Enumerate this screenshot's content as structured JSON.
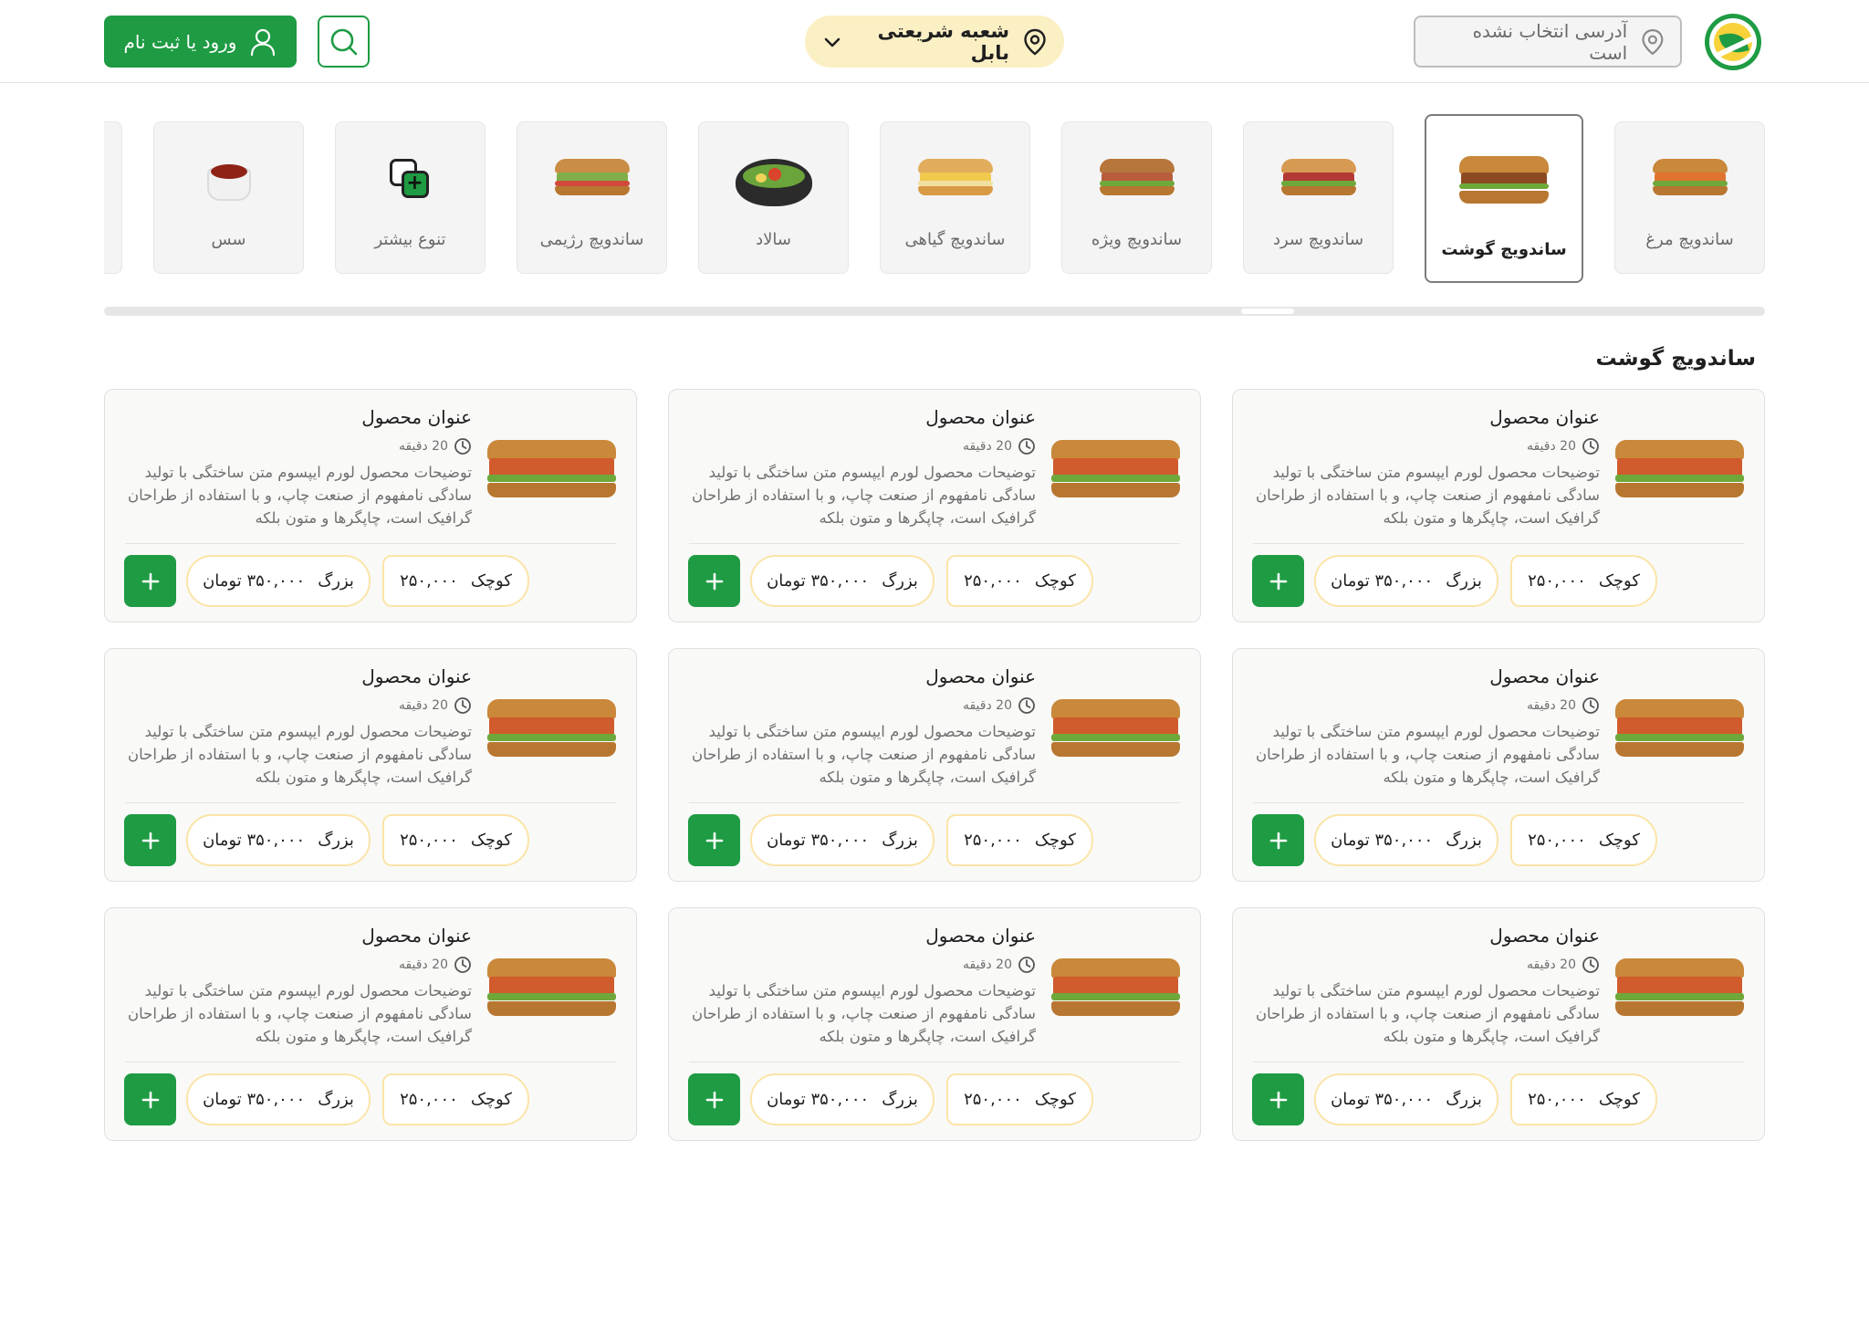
{
  "header": {
    "address_placeholder": "آدرسی انتخاب نشده است",
    "branch_label": "شعبه شریعتی بابل",
    "login_label": "ورود یا ثبت نام"
  },
  "categories": [
    {
      "label": "ساندویچ مرغ",
      "image": "chicken-sandwich",
      "active": false
    },
    {
      "label": "ساندویچ گوشت",
      "image": "meat-sandwich",
      "active": true
    },
    {
      "label": "ساندویچ سرد",
      "image": "cold-sandwich",
      "active": false
    },
    {
      "label": "ساندویچ ویژه",
      "image": "special-sandwich",
      "active": false
    },
    {
      "label": "ساندویچ گیاهی",
      "image": "veggie-sandwich",
      "active": false
    },
    {
      "label": "سالاد",
      "image": "salad-bowl",
      "active": false
    },
    {
      "label": "ساندویچ رژیمی",
      "image": "diet-sandwich",
      "active": false
    },
    {
      "label": "تنوع بیشتر",
      "image": "more-variety-icon",
      "active": false
    },
    {
      "label": "سس",
      "image": "sauce-cup",
      "active": false
    }
  ],
  "section": {
    "title": "ساندویچ گوشت"
  },
  "products": [
    {
      "title": "عنوان محصول",
      "time": "20 دقیقه",
      "desc": "توضیحات محصول لورم ایپسوم متن ساختگی با تولید سادگی نامفهوم از صنعت چاپ، و با استفاده از طراحان گرافیک است، چاپگرها و متون بلکه",
      "small_label": "کوچک",
      "small_price": "۲۵۰,۰۰۰",
      "large_label": "بزرگ",
      "large_price": "۳۵۰,۰۰۰ تومان"
    },
    {
      "title": "عنوان محصول",
      "time": "20 دقیقه",
      "desc": "توضیحات محصول لورم ایپسوم متن ساختگی با تولید سادگی نامفهوم از صنعت چاپ، و با استفاده از طراحان گرافیک است، چاپگرها و متون بلکه",
      "small_label": "کوچک",
      "small_price": "۲۵۰,۰۰۰",
      "large_label": "بزرگ",
      "large_price": "۳۵۰,۰۰۰ تومان"
    },
    {
      "title": "عنوان محصول",
      "time": "20 دقیقه",
      "desc": "توضیحات محصول لورم ایپسوم متن ساختگی با تولید سادگی نامفهوم از صنعت چاپ، و با استفاده از طراحان گرافیک است، چاپگرها و متون بلکه",
      "small_label": "کوچک",
      "small_price": "۲۵۰,۰۰۰",
      "large_label": "بزرگ",
      "large_price": "۳۵۰,۰۰۰ تومان"
    },
    {
      "title": "عنوان محصول",
      "time": "20 دقیقه",
      "desc": "توضیحات محصول لورم ایپسوم متن ساختگی با تولید سادگی نامفهوم از صنعت چاپ، و با استفاده از طراحان گرافیک است، چاپگرها و متون بلکه",
      "small_label": "کوچک",
      "small_price": "۲۵۰,۰۰۰",
      "large_label": "بزرگ",
      "large_price": "۳۵۰,۰۰۰ تومان"
    },
    {
      "title": "عنوان محصول",
      "time": "20 دقیقه",
      "desc": "توضیحات محصول لورم ایپسوم متن ساختگی با تولید سادگی نامفهوم از صنعت چاپ، و با استفاده از طراحان گرافیک است، چاپگرها و متون بلکه",
      "small_label": "کوچک",
      "small_price": "۲۵۰,۰۰۰",
      "large_label": "بزرگ",
      "large_price": "۳۵۰,۰۰۰ تومان"
    },
    {
      "title": "عنوان محصول",
      "time": "20 دقیقه",
      "desc": "توضیحات محصول لورم ایپسوم متن ساختگی با تولید سادگی نامفهوم از صنعت چاپ، و با استفاده از طراحان گرافیک است، چاپگرها و متون بلکه",
      "small_label": "کوچک",
      "small_price": "۲۵۰,۰۰۰",
      "large_label": "بزرگ",
      "large_price": "۳۵۰,۰۰۰ تومان"
    },
    {
      "title": "عنوان محصول",
      "time": "20 دقیقه",
      "desc": "توضیحات محصول لورم ایپسوم متن ساختگی با تولید سادگی نامفهوم از صنعت چاپ، و با استفاده از طراحان گرافیک است، چاپگرها و متون بلکه",
      "small_label": "کوچک",
      "small_price": "۲۵۰,۰۰۰",
      "large_label": "بزرگ",
      "large_price": "۳۵۰,۰۰۰ تومان"
    },
    {
      "title": "عنوان محصول",
      "time": "20 دقیقه",
      "desc": "توضیحات محصول لورم ایپسوم متن ساختگی با تولید سادگی نامفهوم از صنعت چاپ، و با استفاده از طراحان گرافیک است، چاپگرها و متون بلکه",
      "small_label": "کوچک",
      "small_price": "۲۵۰,۰۰۰",
      "large_label": "بزرگ",
      "large_price": "۳۵۰,۰۰۰ تومان"
    },
    {
      "title": "عنوان محصول",
      "time": "20 دقیقه",
      "desc": "توضیحات محصول لورم ایپسوم متن ساختگی با تولید سادگی نامفهوم از صنعت چاپ، و با استفاده از طراحان گرافیک است، چاپگرها و متون بلکه",
      "small_label": "کوچک",
      "small_price": "۲۵۰,۰۰۰",
      "large_label": "بزرگ",
      "large_price": "۳۵۰,۰۰۰ تومان"
    }
  ],
  "colors": {
    "brand_green": "#1e9b43",
    "branch_pill": "#fbefc4",
    "price_border": "#fbe4a7",
    "brand_yellow": "#f7d23a"
  }
}
